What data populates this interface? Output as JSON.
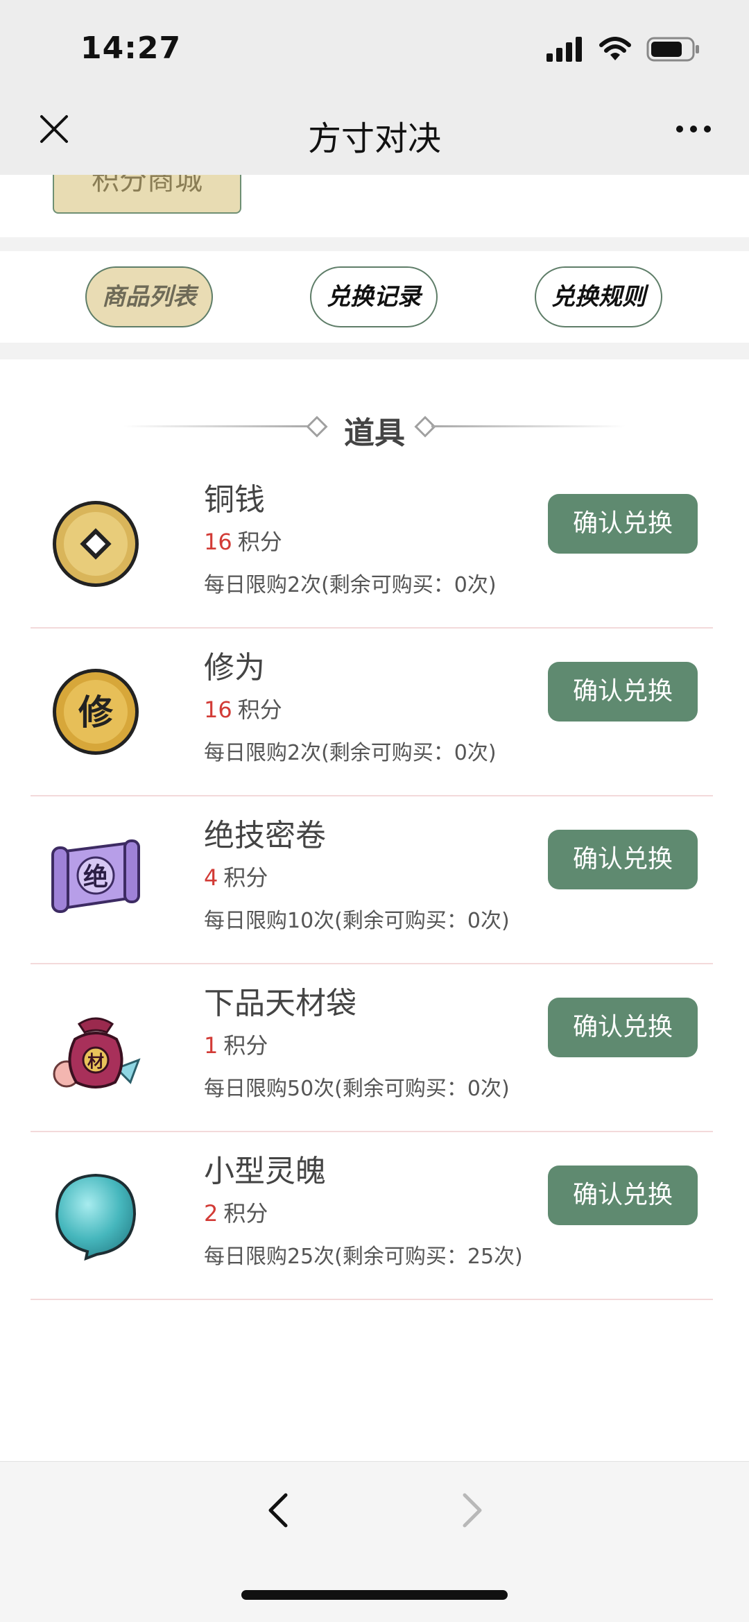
{
  "status_bar": {
    "time": "14:27"
  },
  "header": {
    "title": "方寸对决"
  },
  "banner": {
    "button_label": "积分商城"
  },
  "tabs": [
    {
      "label": "商品列表",
      "active": true
    },
    {
      "label": "兑换记录",
      "active": false
    },
    {
      "label": "兑换规则",
      "active": false
    }
  ],
  "section": {
    "title": "道具"
  },
  "items": [
    {
      "name": "铜钱",
      "points": "16",
      "points_unit": "积分",
      "limit": "每日限购2次(剩余可购买：0次)",
      "button": "确认兑换",
      "icon": "copper-coin-icon"
    },
    {
      "name": "修为",
      "points": "16",
      "points_unit": "积分",
      "limit": "每日限购2次(剩余可购买：0次)",
      "button": "确认兑换",
      "icon": "cultivation-coin-icon"
    },
    {
      "name": "绝技密卷",
      "points": "4",
      "points_unit": "积分",
      "limit": "每日限购10次(剩余可购买：0次)",
      "button": "确认兑换",
      "icon": "scroll-icon"
    },
    {
      "name": "下品天材袋",
      "points": "1",
      "points_unit": "积分",
      "limit": "每日限购50次(剩余可购买：0次)",
      "button": "确认兑换",
      "icon": "material-bag-icon"
    },
    {
      "name": "小型灵魄",
      "points": "2",
      "points_unit": "积分",
      "limit": "每日限购25次(剩余可购买：25次)",
      "button": "确认兑换",
      "icon": "spirit-orb-icon"
    }
  ],
  "colors": {
    "accent_green": "#5f8a70",
    "points_red": "#d23b36",
    "tab_active_bg": "#e9dcb4"
  }
}
